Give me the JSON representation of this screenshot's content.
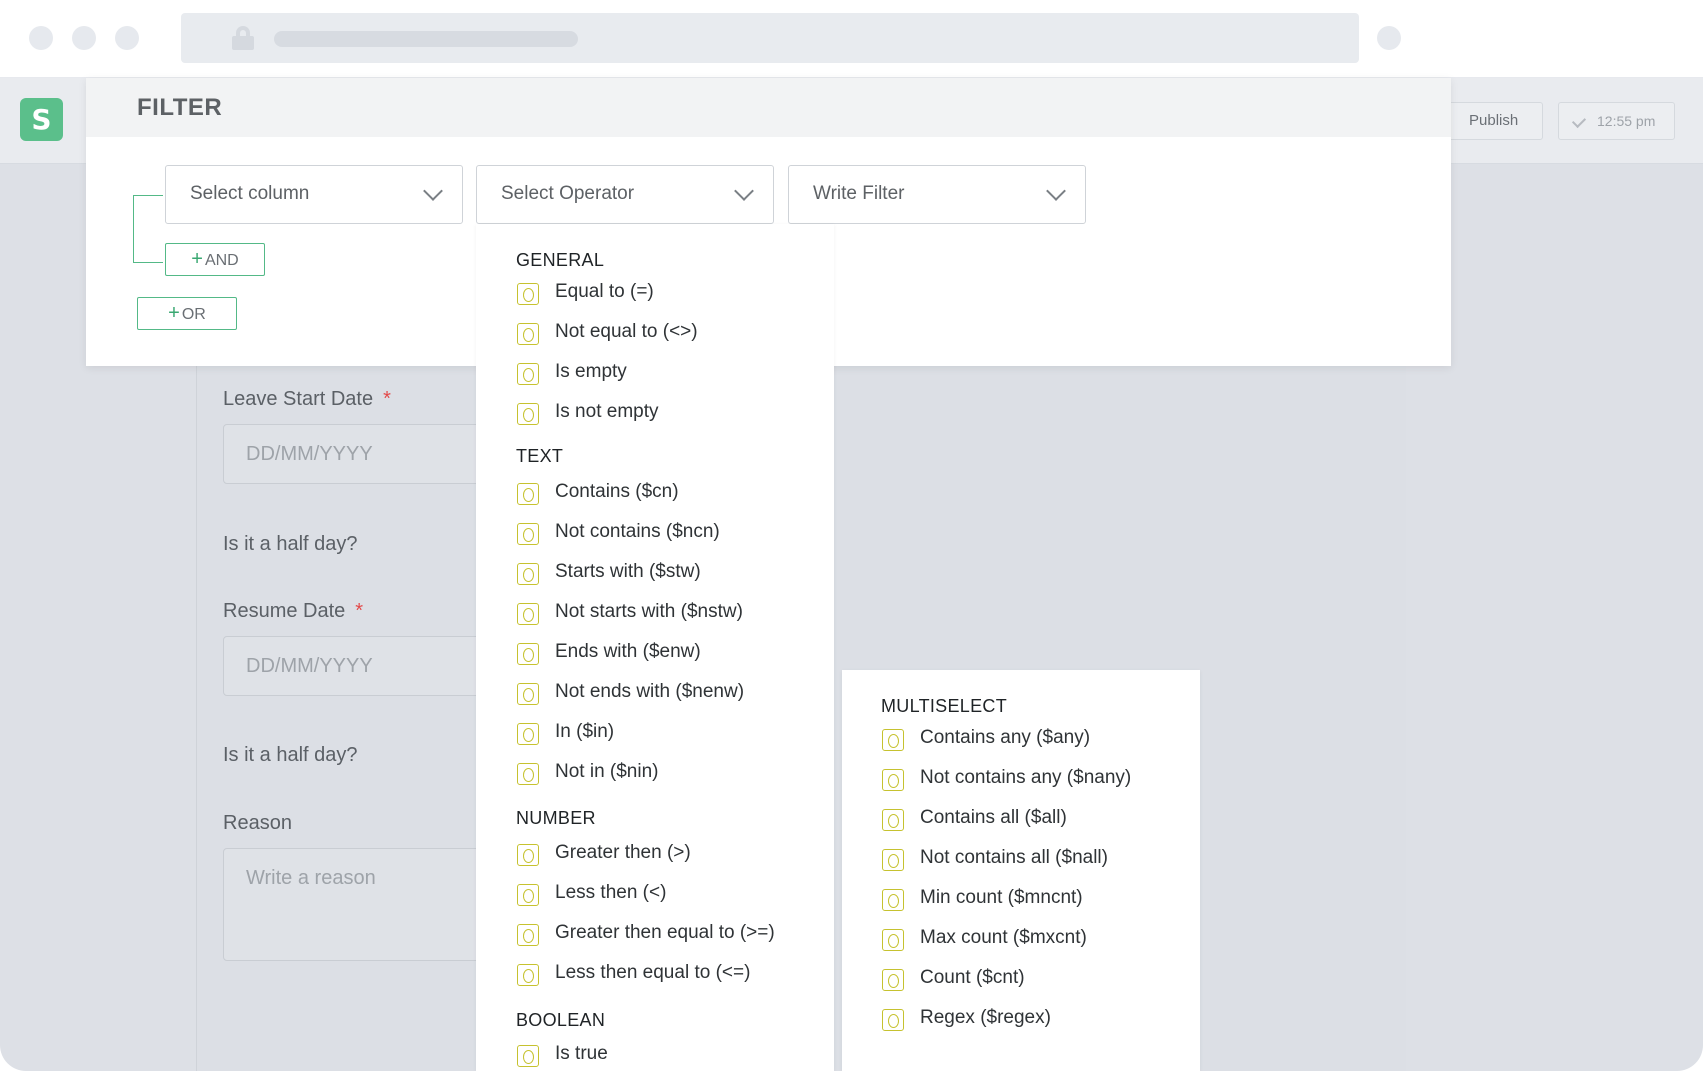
{
  "browser": {
    "controls": [
      "close-dot",
      "minimize-dot",
      "maximize-dot"
    ]
  },
  "header": {
    "logo_letter": "S",
    "publish_label": "Publish",
    "status_time": "12:55 pm"
  },
  "form": {
    "leave_start_label": "Leave Start Date",
    "leave_start_placeholder": "DD/MM/YYYY",
    "half_day_1": "Is it a half day?",
    "resume_label": "Resume Date",
    "resume_placeholder": "DD/MM/YYYY",
    "half_day_2": "Is it a half day?",
    "reason_label": "Reason",
    "reason_placeholder": "Write a reason",
    "required_mark": "*"
  },
  "filter": {
    "title": "FILTER",
    "select_column": "Select column",
    "select_operator": "Select Operator",
    "write_filter": "Write Filter",
    "and_label": "AND",
    "or_label": "OR",
    "plus": "+"
  },
  "operators": {
    "general": {
      "heading": "GENERAL",
      "items": [
        "Equal to (=)",
        "Not equal to (<>)",
        "Is empty",
        "Is not empty"
      ]
    },
    "text": {
      "heading": "TEXT",
      "items": [
        "Contains ($cn)",
        "Not contains ($ncn)",
        "Starts with ($stw)",
        "Not starts with ($nstw)",
        "Ends with ($enw)",
        "Not ends with ($nenw)",
        "In ($in)",
        "Not in ($nin)"
      ]
    },
    "number": {
      "heading": "NUMBER",
      "items": [
        "Greater then (>)",
        "Less then (<)",
        "Greater then equal to (>=)",
        "Less then equal to (<=)"
      ]
    },
    "boolean": {
      "heading": "BOOLEAN",
      "items": [
        "Is true"
      ]
    },
    "multiselect": {
      "heading": "MULTISELECT",
      "items": [
        "Contains any ($any)",
        "Not contains any ($nany)",
        "Contains all ($all)",
        "Not contains all ($nall)",
        "Min count ($mncnt)",
        "Max count ($mxcnt)",
        "Count ($cnt)",
        "Regex ($regex)"
      ]
    }
  },
  "colors": {
    "accent_green": "#53b987",
    "option_icon": "#c6c22f",
    "required": "#e34a4a"
  }
}
